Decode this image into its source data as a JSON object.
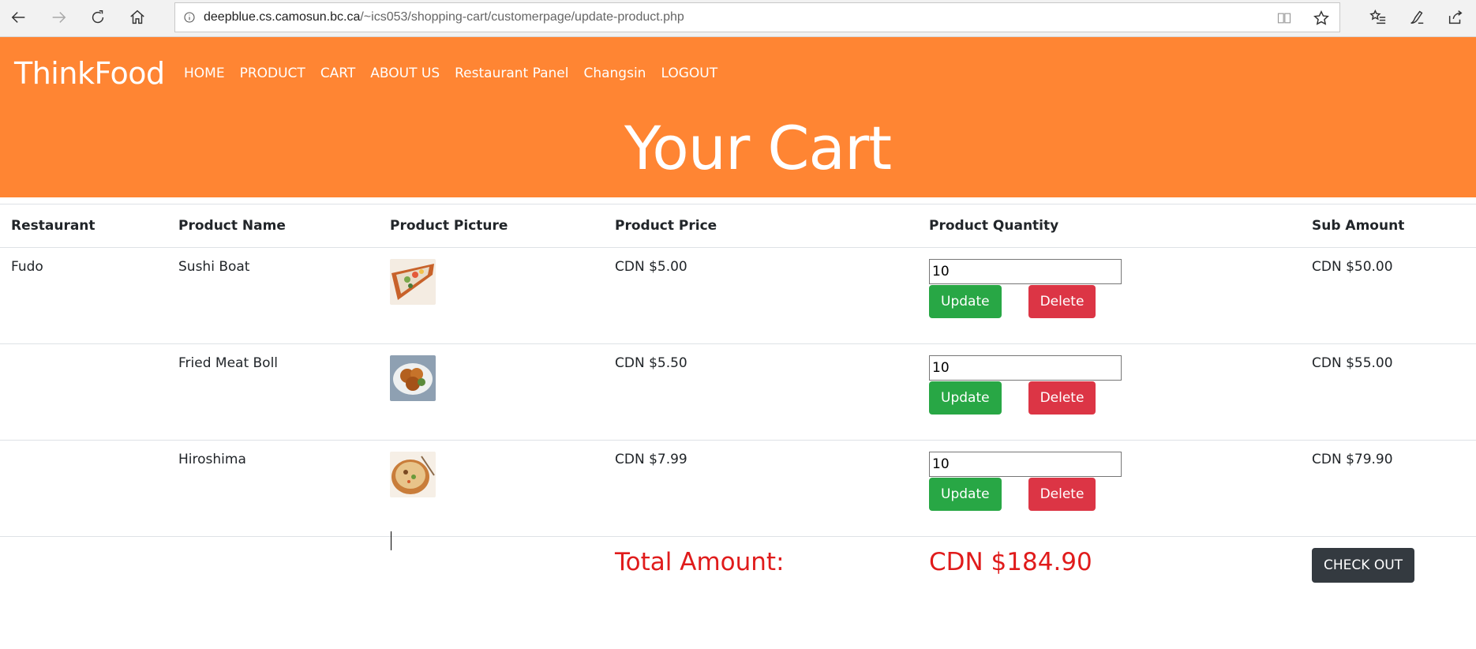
{
  "browser": {
    "url_host": "deepblue.cs.camosun.bc.ca",
    "url_path": "/~ics053/shopping-cart/customerpage/update-product.php"
  },
  "site": {
    "brand": "ThinkFood",
    "nav": [
      "HOME",
      "PRODUCT",
      "CART",
      "ABOUT US",
      "Restaurant Panel",
      "Changsin",
      "LOGOUT"
    ],
    "hero_title": "Your Cart"
  },
  "table": {
    "headers": {
      "restaurant": "Restaurant",
      "name": "Product Name",
      "picture": "Product Picture",
      "price": "Product Price",
      "quantity": "Product Quantity",
      "sub": "Sub Amount"
    },
    "rows": [
      {
        "restaurant": "Fudo",
        "name": "Sushi Boat",
        "price": "CDN $5.00",
        "quantity": "10",
        "sub": "CDN $50.00",
        "image": "sushi-boat"
      },
      {
        "restaurant": "",
        "name": "Fried Meat Boll",
        "price": "CDN $5.50",
        "quantity": "10",
        "sub": "CDN $55.00",
        "image": "fried-meatball"
      },
      {
        "restaurant": "",
        "name": "Hiroshima",
        "price": "CDN $7.99",
        "quantity": "10",
        "sub": "CDN $79.90",
        "image": "hiroshima"
      }
    ],
    "update_label": "Update",
    "delete_label": "Delete",
    "total_label": "Total Amount:",
    "total_value": "CDN $184.90",
    "checkout_label": "CHECK OUT"
  },
  "colors": {
    "header": "#ff8533",
    "update": "#28a745",
    "delete": "#dc3545",
    "checkout": "#343a40",
    "total": "#e01b1b"
  }
}
